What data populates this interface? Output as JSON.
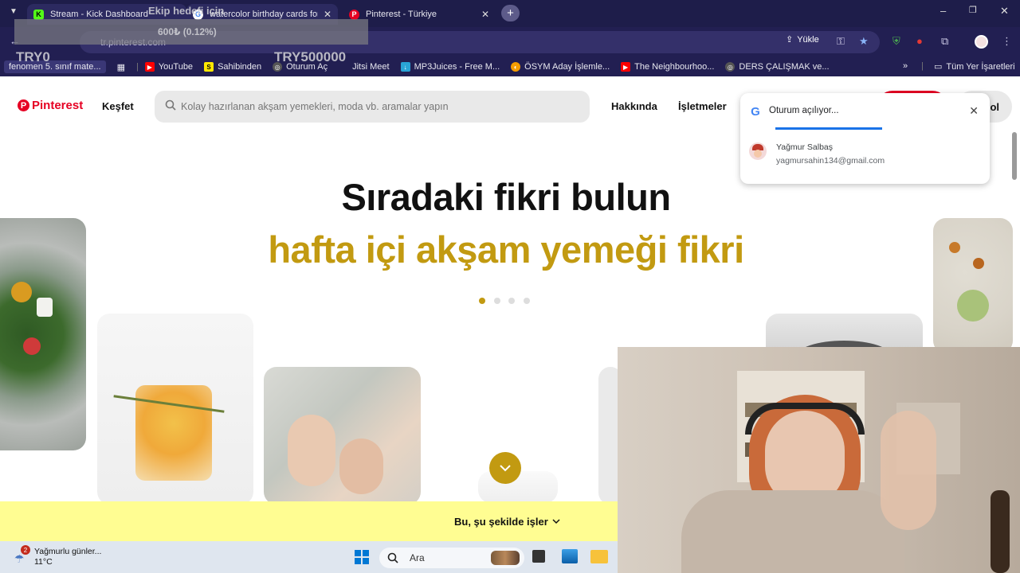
{
  "browser": {
    "tabs": [
      {
        "title": "Stream - Kick Dashboard",
        "favicon": "kick-icon"
      },
      {
        "title": "watercolor birthday cards for m",
        "favicon": "google-icon"
      },
      {
        "title": "Pinterest - Türkiye",
        "favicon": "pinterest-icon"
      }
    ],
    "url": "tr.pinterest.com",
    "upload_label": "Yükle",
    "bookmarks": [
      "fenomen 5. sınıf mate...",
      "YouTube",
      "Sahibinden",
      "Oturum Aç",
      "Jitsi Meet",
      "MP3Juices - Free M...",
      "ÖSYM Aday İşlemle...",
      "The Neighbourhoo...",
      "DERS ÇALIŞMAK ve..."
    ],
    "all_bookmarks": "Tüm Yer İşaretleri"
  },
  "overlay": {
    "team_label": "Ekip hedefi için",
    "progress_text": "600₺ (0.12%)",
    "left_amount": "TRY0",
    "right_amount": "TRY500000"
  },
  "pinterest": {
    "logo": "Pinterest",
    "explore": "Keşfet",
    "search_placeholder": "Kolay hazırlanan akşam yemekleri, moda vb. aramalar yapın",
    "about": "Hakkında",
    "business": "İşletmeler",
    "login_partial": "ol",
    "hero_title": "Sıradaki fikri bulun",
    "hero_subtitle": "hafta içi akşam yemeği fikri",
    "how_it_works": "Bu, şu şekilde işler",
    "accent_color": "#c29a11",
    "brand_color": "#e60023"
  },
  "google_signin": {
    "title": "Oturum açılıyor...",
    "user_name": "Yağmur Salbaş",
    "user_email": "yagmursahin134@gmail.com"
  },
  "taskbar": {
    "weather_text": "Yağmurlu günler...",
    "temperature": "11°C",
    "badge_count": "2",
    "search_label": "Ara"
  }
}
